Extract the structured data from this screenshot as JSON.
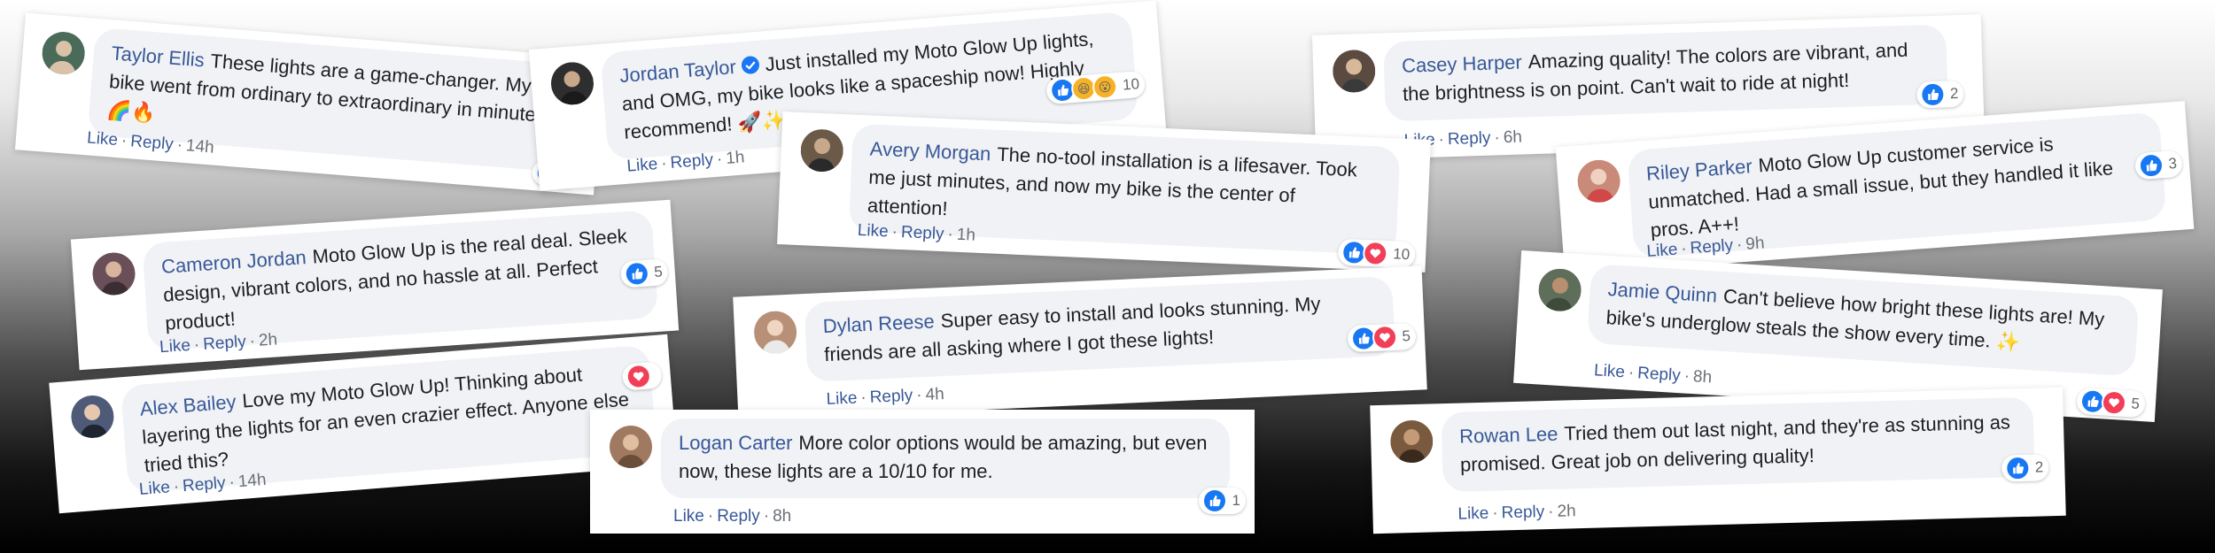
{
  "actions": {
    "like": "Like",
    "reply": "Reply",
    "sep": "·"
  },
  "comments": [
    {
      "name": "Taylor Ellis",
      "text": "These lights are a game-changer. My bike went from ordinary to extraordinary in minutes. 🌈🔥",
      "time": "14h",
      "reactions": [
        "like"
      ],
      "count": "1",
      "avatar_color": "#4a6a5a"
    },
    {
      "name": "Jordan Taylor",
      "verified": true,
      "text": "Just installed my Moto Glow Up lights, and OMG, my bike looks like a spaceship now! Highly recommend! 🚀✨",
      "time": "1h",
      "reactions": [
        "like",
        "haha",
        "wow"
      ],
      "count": "10",
      "avatar_color": "#2e2e2e"
    },
    {
      "name": "Casey Harper",
      "text": "Amazing quality! The colors are vibrant, and the brightness is on point. Can't wait to ride at night!",
      "time": "6h",
      "reactions": [
        "like"
      ],
      "count": "2",
      "avatar_color": "#5a4a40"
    },
    {
      "name": "Avery Morgan",
      "text": "The no-tool installation is a lifesaver. Took me just minutes, and now my bike is the center of attention!",
      "time": "1h",
      "reactions": [
        "like",
        "love"
      ],
      "count": "10",
      "avatar_color": "#6b5a48"
    },
    {
      "name": "Riley Parker",
      "text": "Moto Glow Up customer service is unmatched. Had a small issue, but they handled it like pros. A++!",
      "time": "9h",
      "reactions": [
        "like"
      ],
      "count": "3",
      "avatar_color": "#c98a7a"
    },
    {
      "name": "Cameron Jordan",
      "text": "Moto Glow Up is the real deal. Sleek design, vibrant colors, and no hassle at all. Perfect product!",
      "time": "2h",
      "reactions": [
        "like"
      ],
      "count": "5",
      "avatar_color": "#6a4e58"
    },
    {
      "name": "Dylan Reese",
      "text": "Super easy to install and looks stunning. My friends are all asking where I got these lights!",
      "time": "4h",
      "reactions": [
        "like",
        "love"
      ],
      "count": "5",
      "avatar_color": "#b89078"
    },
    {
      "name": "Jamie Quinn",
      "text": "Can't believe how bright these lights are! My bike's underglow steals the show every time. ✨",
      "time": "8h",
      "reactions": [
        "like",
        "love"
      ],
      "count": "5",
      "avatar_color": "#5e6e5a"
    },
    {
      "name": "Alex Bailey",
      "text": "Love my Moto Glow Up! Thinking about layering the lights for an even crazier effect. Anyone else tried this?",
      "time": "14h",
      "reactions": [
        "love"
      ],
      "count": "",
      "avatar_color": "#4e5a78"
    },
    {
      "name": "Logan Carter",
      "text": "More color options would be amazing, but even now, these lights are a 10/10 for me.",
      "time": "8h",
      "reactions": [
        "like"
      ],
      "count": "1",
      "avatar_color": "#a07a60"
    },
    {
      "name": "Rowan Lee",
      "text": "Tried them out last night, and they're as stunning as promised. Great job on delivering quality!",
      "time": "2h",
      "reactions": [
        "like"
      ],
      "count": "2",
      "avatar_color": "#7a5a3e"
    }
  ]
}
